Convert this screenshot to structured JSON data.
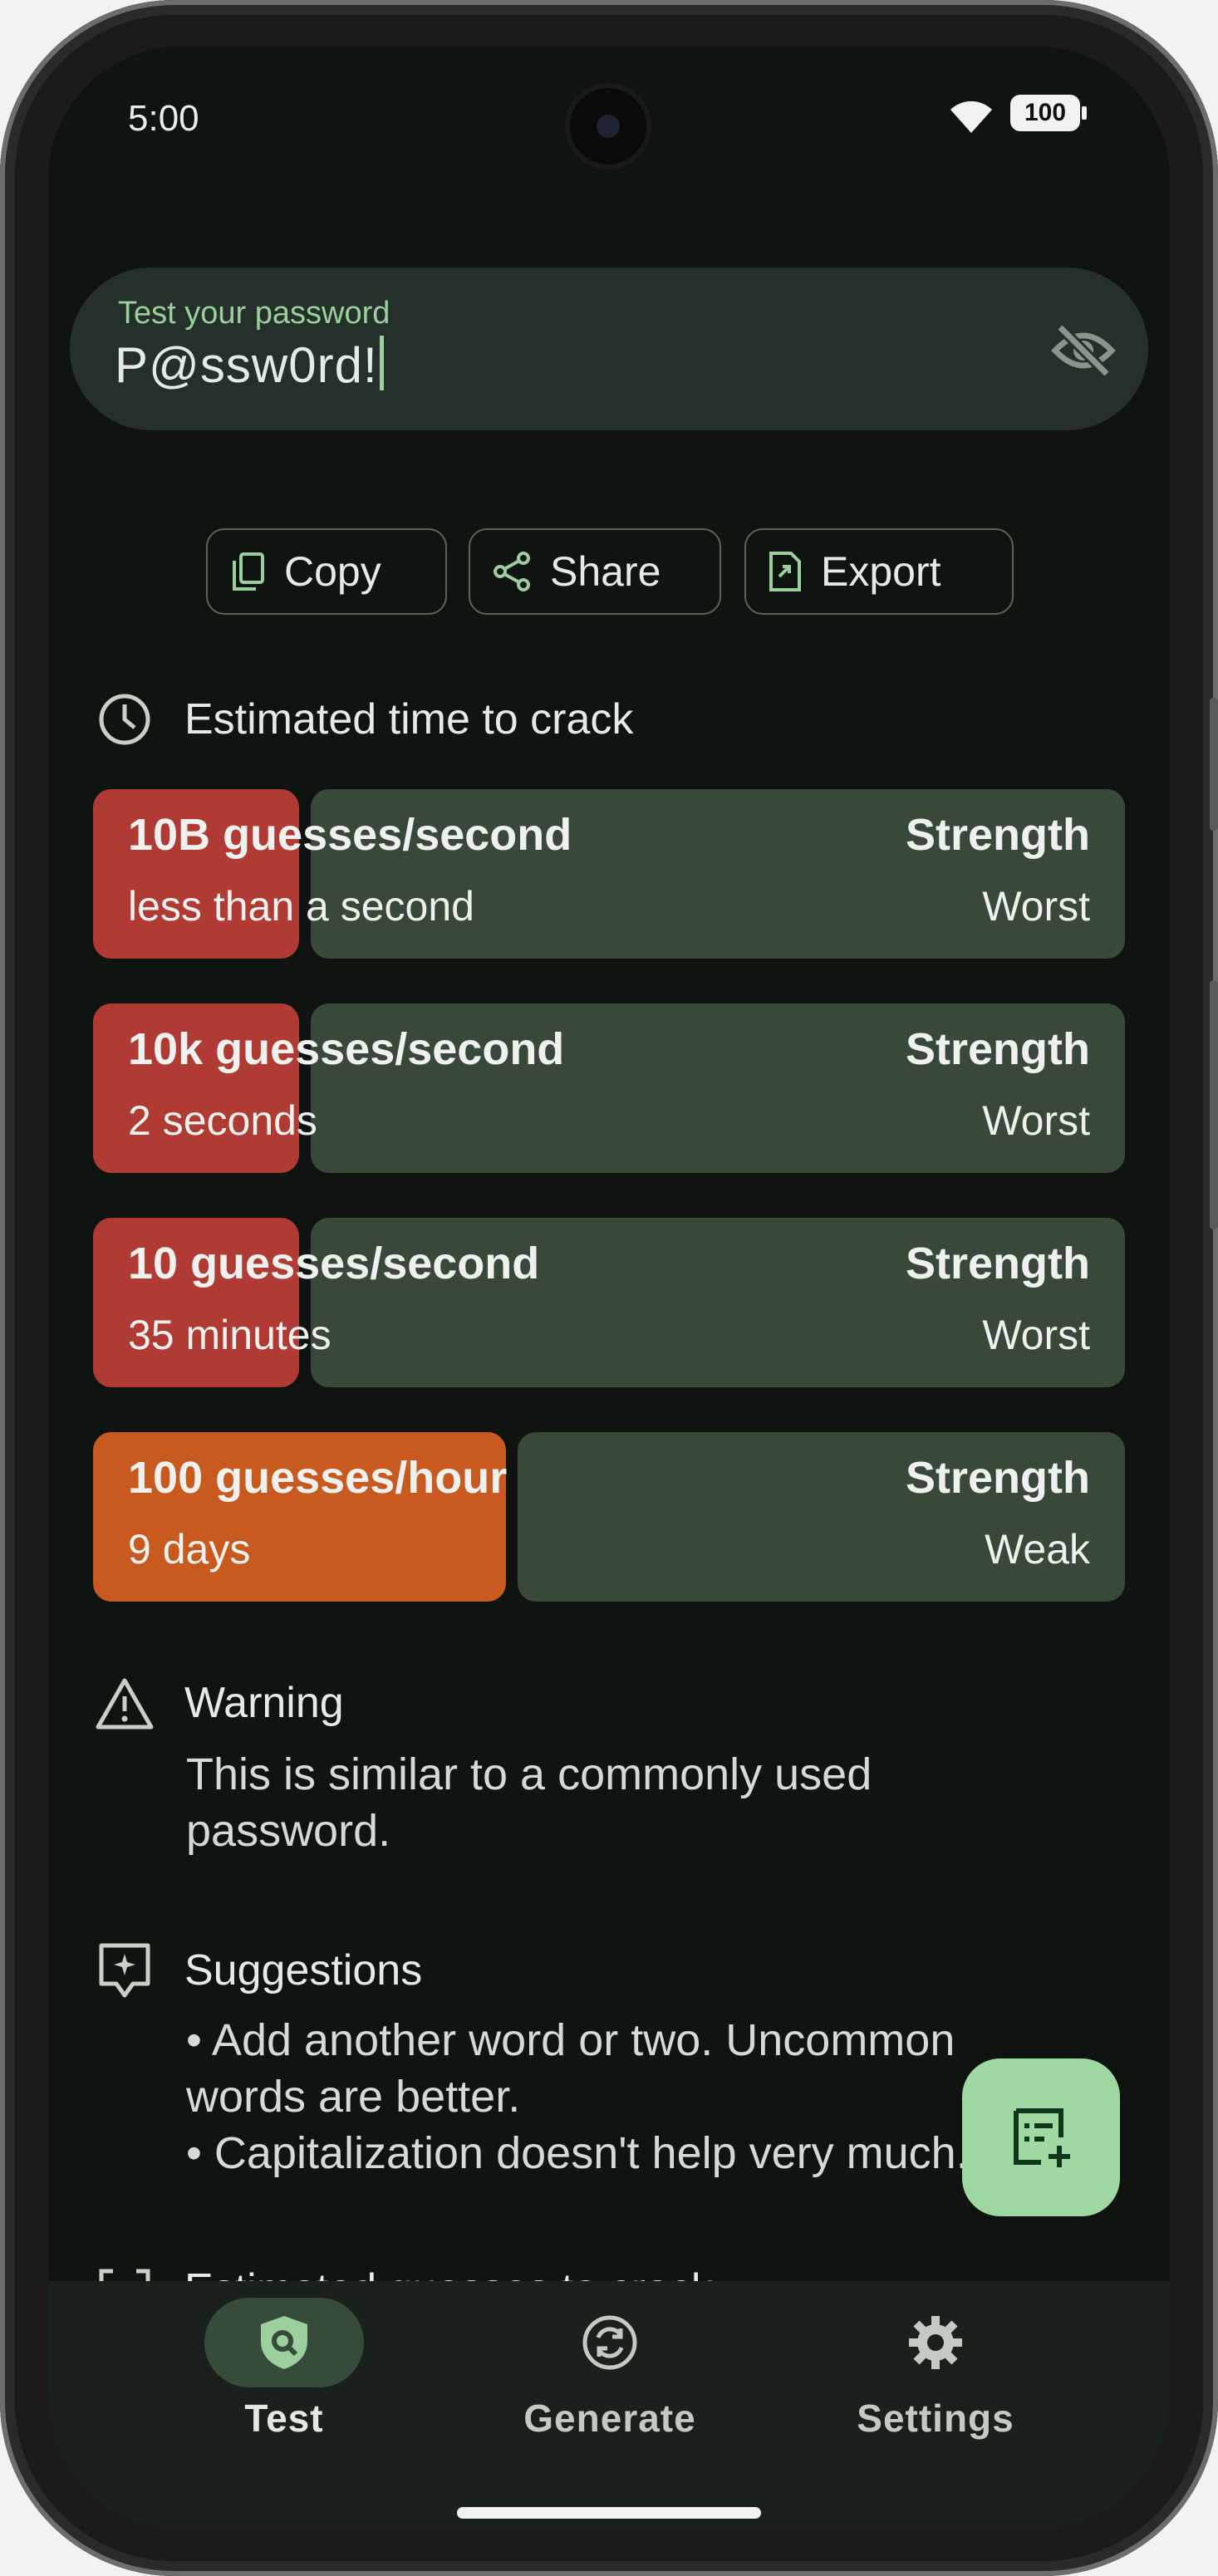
{
  "status_bar": {
    "time": "5:00",
    "battery": "100"
  },
  "password_field": {
    "label": "Test your password",
    "value": "P@ssw0rd!"
  },
  "actions": {
    "copy": "Copy",
    "share": "Share",
    "export": "Export"
  },
  "crack_time": {
    "title": "Estimated time to crack",
    "rows": [
      {
        "rate": "10B guesses/second",
        "time": "less than a second",
        "strength_label": "Strength",
        "strength": "Worst",
        "fill_fraction": 0.2,
        "fill_color": "#b03b34"
      },
      {
        "rate": "10k guesses/second",
        "time": "2 seconds",
        "strength_label": "Strength",
        "strength": "Worst",
        "fill_fraction": 0.2,
        "fill_color": "#b03b34"
      },
      {
        "rate": "10 guesses/second",
        "time": "35 minutes",
        "strength_label": "Strength",
        "strength": "Worst",
        "fill_fraction": 0.2,
        "fill_color": "#b03b34"
      },
      {
        "rate": "100 guesses/hour",
        "time": "9 days",
        "strength_label": "Strength",
        "strength": "Weak",
        "fill_fraction": 0.4,
        "fill_color": "#c8591f"
      }
    ]
  },
  "warning": {
    "title": "Warning",
    "text_line1": "This is similar to a commonly used",
    "text_line2": "password."
  },
  "suggestions": {
    "title": "Suggestions",
    "line1": "• Add another word or two. Uncommon",
    "line2": "words are better.",
    "line3": "• Capitalization doesn't help very much."
  },
  "next_section": {
    "title": "Estimated guesses to crack"
  },
  "nav": {
    "test": "Test",
    "generate": "Generate",
    "settings": "Settings"
  },
  "colors": {
    "accent": "#9ccf9e",
    "background": "#0f1410",
    "card": "#394839"
  }
}
